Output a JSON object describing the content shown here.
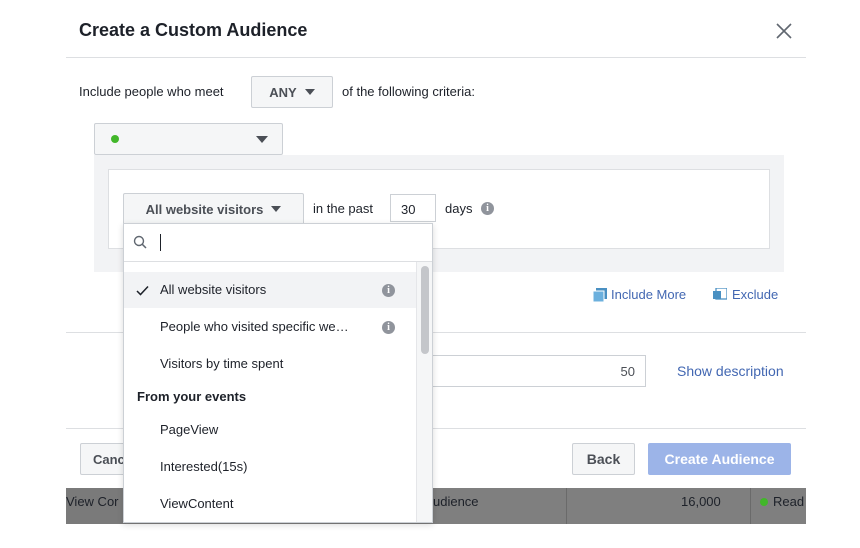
{
  "dialog": {
    "title": "Create a Custom Audience"
  },
  "criteria": {
    "prefix": "Include people who meet",
    "match_value": "ANY",
    "suffix": "of the following criteria:"
  },
  "rule": {
    "visitors_select": "All website visitors",
    "in_the_past": "in the past",
    "days_value": "30",
    "days_label": "days",
    "include_more": "Include More",
    "exclude": "Exclude"
  },
  "dropdown": {
    "search_placeholder": "",
    "items": [
      {
        "label": "All website visitors",
        "selected": true,
        "info": true
      },
      {
        "label": "People who visited specific we…",
        "selected": false,
        "info": true
      },
      {
        "label": "Visitors by time spent",
        "selected": false,
        "info": false
      }
    ],
    "section_header": "From your events",
    "event_items": [
      "PageView",
      "Interested(15s)",
      "ViewContent"
    ]
  },
  "audience_name": {
    "char_count": "50",
    "show_description": "Show description"
  },
  "footer": {
    "cancel_label": "Cancel",
    "back_label": "Back",
    "create_label": "Create Audience"
  },
  "background_row": {
    "left_text": "View Cor",
    "middle_text": "udience",
    "size": "16,000",
    "status": "Read"
  },
  "colors": {
    "accent": "#4267b2",
    "create_button_disabled": "#9cb4e8",
    "status_green": "#42b72a",
    "selected_row": "#f2f3f5"
  }
}
